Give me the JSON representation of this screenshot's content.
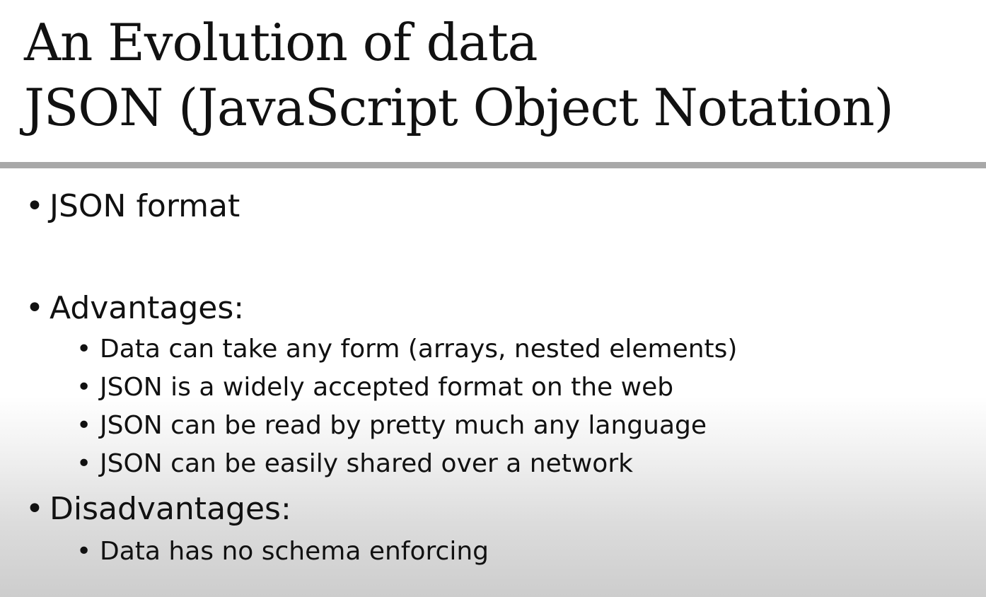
{
  "title": {
    "line1": "An Evolution of data",
    "line2": "JSON (JavaScript Object Notation)"
  },
  "bullet_char": "•",
  "content": {
    "item1": "JSON format",
    "advantages": {
      "label": "Advantages:",
      "items": [
        "Data can take any form (arrays, nested elements)",
        "JSON is a widely accepted format on the web",
        "JSON can be read by pretty much any language",
        "JSON can be easily shared over a network"
      ]
    },
    "disadvantages": {
      "label": "Disadvantages:",
      "items": [
        "Data has no schema enforcing"
      ]
    }
  },
  "colors": {
    "text": "#111111",
    "divider": "#a8a8a8",
    "background_top": "#ffffff",
    "background_bottom": "#cdcdcd"
  }
}
